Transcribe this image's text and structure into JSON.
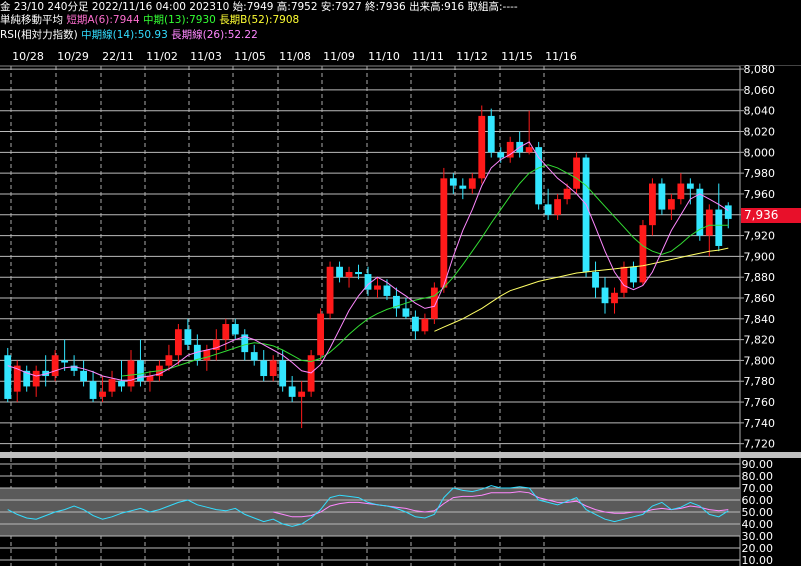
{
  "header": {
    "line1": "金 23/10 240分足 2022/11/16 04:00 202310 始:7949 高:7952 安:7927 終:7936 出来高:916 取組高:----",
    "ma_title": "単純移動平均",
    "ma_short": "短期A(6):7944",
    "ma_mid": "中期(13):7930",
    "ma_long": "長期B(52):7908",
    "rsi_title": "RSI(相対力指数)",
    "rsi_mid": "中期線(14):50.93",
    "rsi_long": "長期線(26):52.22"
  },
  "price_tag": "7,936",
  "colors": {
    "up": "#ff1a1a",
    "down": "#33e6ff",
    "ma_short": "#ff88ff",
    "ma_mid": "#33dd33",
    "ma_long": "#ffff66",
    "rsi_mid": "#33ddff",
    "rsi_long": "#ff88ff",
    "tag": "#e8102a"
  },
  "chart_data": [
    {
      "type": "candlestick",
      "x_labels": [
        "10/28",
        "10/29",
        "22/11",
        "11/02",
        "11/03",
        "11/05",
        "11/08",
        "11/09",
        "11/10",
        "11/11",
        "11/12",
        "11/15",
        "11/16"
      ],
      "y_ticks": [
        "8,080",
        "8,060",
        "8,040",
        "8,020",
        "8,000",
        "7,980",
        "7,960",
        "7,940",
        "7,920",
        "7,900",
        "7,880",
        "7,860",
        "7,840",
        "7,820",
        "7,800",
        "7,780",
        "7,760",
        "7,740",
        "7,720"
      ],
      "ylim": [
        7712,
        8082
      ],
      "grid": true,
      "candles": [
        [
          7805,
          7812,
          7760,
          7763
        ],
        [
          7770,
          7800,
          7760,
          7795
        ],
        [
          7790,
          7795,
          7770,
          7775
        ],
        [
          7775,
          7795,
          7765,
          7790
        ],
        [
          7790,
          7805,
          7775,
          7785
        ],
        [
          7785,
          7810,
          7780,
          7805
        ],
        [
          7800,
          7820,
          7790,
          7798
        ],
        [
          7795,
          7805,
          7785,
          7790
        ],
        [
          7790,
          7800,
          7775,
          7780
        ],
        [
          7780,
          7790,
          7760,
          7763
        ],
        [
          7765,
          7785,
          7760,
          7770
        ],
        [
          7770,
          7790,
          7765,
          7782
        ],
        [
          7780,
          7800,
          7770,
          7775
        ],
        [
          7775,
          7810,
          7770,
          7800
        ],
        [
          7800,
          7820,
          7775,
          7780
        ],
        [
          7780,
          7790,
          7770,
          7785
        ],
        [
          7785,
          7800,
          7780,
          7795
        ],
        [
          7795,
          7815,
          7790,
          7805
        ],
        [
          7805,
          7835,
          7795,
          7830
        ],
        [
          7830,
          7840,
          7810,
          7815
        ],
        [
          7815,
          7825,
          7795,
          7800
        ],
        [
          7800,
          7815,
          7790,
          7810
        ],
        [
          7810,
          7830,
          7800,
          7820
        ],
        [
          7820,
          7840,
          7810,
          7835
        ],
        [
          7835,
          7840,
          7820,
          7825
        ],
        [
          7825,
          7830,
          7800,
          7808
        ],
        [
          7808,
          7815,
          7795,
          7800
        ],
        [
          7800,
          7810,
          7780,
          7785
        ],
        [
          7785,
          7805,
          7780,
          7800
        ],
        [
          7800,
          7810,
          7770,
          7775
        ],
        [
          7775,
          7785,
          7760,
          7765
        ],
        [
          7765,
          7780,
          7735,
          7770
        ],
        [
          7770,
          7810,
          7765,
          7805
        ],
        [
          7805,
          7850,
          7800,
          7845
        ],
        [
          7845,
          7895,
          7840,
          7890
        ],
        [
          7890,
          7895,
          7875,
          7880
        ],
        [
          7880,
          7890,
          7870,
          7885
        ],
        [
          7885,
          7892,
          7878,
          7883
        ],
        [
          7883,
          7890,
          7862,
          7868
        ],
        [
          7868,
          7880,
          7860,
          7872
        ],
        [
          7872,
          7878,
          7858,
          7862
        ],
        [
          7862,
          7870,
          7842,
          7850
        ],
        [
          7850,
          7860,
          7840,
          7842
        ],
        [
          7842,
          7848,
          7820,
          7828
        ],
        [
          7828,
          7845,
          7825,
          7840
        ],
        [
          7840,
          7875,
          7835,
          7870
        ],
        [
          7870,
          7985,
          7865,
          7975
        ],
        [
          7975,
          7980,
          7960,
          7968
        ],
        [
          7968,
          7975,
          7955,
          7965
        ],
        [
          7965,
          7980,
          7960,
          7975
        ],
        [
          7975,
          8045,
          7970,
          8035
        ],
        [
          8035,
          8042,
          7995,
          8000
        ],
        [
          8000,
          8005,
          7990,
          7995
        ],
        [
          7995,
          8015,
          7990,
          8010
        ],
        [
          8010,
          8020,
          7995,
          8000
        ],
        [
          8000,
          8040,
          7998,
          8005
        ],
        [
          8005,
          8010,
          7945,
          7950
        ],
        [
          7950,
          7965,
          7935,
          7940
        ],
        [
          7940,
          7960,
          7935,
          7955
        ],
        [
          7955,
          7970,
          7950,
          7965
        ],
        [
          7965,
          8000,
          7960,
          7995
        ],
        [
          7995,
          7998,
          7880,
          7885
        ],
        [
          7885,
          7895,
          7860,
          7870
        ],
        [
          7870,
          7880,
          7845,
          7855
        ],
        [
          7855,
          7870,
          7845,
          7865
        ],
        [
          7865,
          7895,
          7860,
          7890
        ],
        [
          7890,
          7895,
          7870,
          7875
        ],
        [
          7875,
          7935,
          7872,
          7930
        ],
        [
          7930,
          7975,
          7920,
          7970
        ],
        [
          7970,
          7975,
          7940,
          7945
        ],
        [
          7945,
          7960,
          7935,
          7955
        ],
        [
          7955,
          7980,
          7950,
          7970
        ],
        [
          7970,
          7975,
          7950,
          7965
        ],
        [
          7965,
          7970,
          7915,
          7920
        ],
        [
          7920,
          7950,
          7900,
          7945
        ],
        [
          7945,
          7970,
          7905,
          7910
        ],
        [
          7949,
          7952,
          7927,
          7936
        ]
      ],
      "ma_short": [
        7795,
        7792,
        7788,
        7785,
        7787,
        7790,
        7793,
        7794,
        7792,
        7789,
        7785,
        7783,
        7781,
        7781,
        7784,
        7785,
        7787,
        7792,
        7798,
        7805,
        7808,
        7810,
        7812,
        7816,
        7820,
        7823,
        7820,
        7815,
        7810,
        7805,
        7798,
        7790,
        7788,
        7796,
        7812,
        7830,
        7848,
        7862,
        7873,
        7880,
        7875,
        7868,
        7862,
        7855,
        7850,
        7852,
        7872,
        7900,
        7925,
        7945,
        7968,
        7985,
        7993,
        7998,
        8005,
        8010,
        7995,
        7985,
        7975,
        7968,
        7960,
        7950,
        7928,
        7905,
        7885,
        7872,
        7868,
        7872,
        7885,
        7905,
        7925,
        7940,
        7955,
        7960,
        7955,
        7950,
        7944
      ],
      "ma_mid": [
        null,
        null,
        null,
        null,
        null,
        null,
        null,
        null,
        null,
        null,
        null,
        null,
        7785,
        7786,
        7787,
        7789,
        7790,
        7792,
        7795,
        7798,
        7801,
        7803,
        7806,
        7809,
        7812,
        7815,
        7817,
        7816,
        7814,
        7810,
        7805,
        7800,
        7799,
        7802,
        7808,
        7816,
        7825,
        7833,
        7840,
        7845,
        7849,
        7852,
        7855,
        7858,
        7860,
        7862,
        7870,
        7880,
        7892,
        7905,
        7918,
        7932,
        7945,
        7958,
        7970,
        7980,
        7985,
        7988,
        7985,
        7980,
        7975,
        7968,
        7958,
        7948,
        7938,
        7928,
        7918,
        7910,
        7905,
        7902,
        7905,
        7912,
        7920,
        7926,
        7930,
        7930,
        7930
      ],
      "ma_long": [
        null,
        null,
        null,
        null,
        null,
        null,
        null,
        null,
        null,
        null,
        null,
        null,
        null,
        null,
        null,
        null,
        null,
        null,
        null,
        null,
        null,
        null,
        null,
        null,
        null,
        null,
        null,
        null,
        null,
        null,
        null,
        null,
        null,
        null,
        null,
        null,
        null,
        null,
        null,
        null,
        null,
        null,
        null,
        null,
        null,
        7828,
        7832,
        7836,
        7840,
        7845,
        7850,
        7856,
        7862,
        7867,
        7870,
        7873,
        7876,
        7878,
        7880,
        7882,
        7884,
        7885,
        7886,
        7887,
        7888,
        7889,
        7890,
        7891,
        7893,
        7895,
        7897,
        7899,
        7901,
        7903,
        7905,
        7906,
        7908
      ]
    },
    {
      "type": "line",
      "title": "RSI",
      "y_ticks": [
        "90.00",
        "80.00",
        "70.00",
        "60.00",
        "50.00",
        "40.00",
        "30.00",
        "20.00",
        "10.00"
      ],
      "ylim": [
        5,
        95
      ],
      "series": [
        {
          "name": "中期線(14)",
          "values": [
            null,
            null,
            null,
            null,
            null,
            null,
            null,
            null,
            null,
            null,
            null,
            null,
            null,
            null,
            null,
            null,
            null,
            null,
            null,
            null,
            null,
            null,
            null,
            null,
            null,
            null,
            null,
            null,
            null,
            null,
            null,
            null,
            null,
            null,
            null,
            null,
            null,
            null,
            null,
            null,
            null,
            null,
            null,
            null,
            null,
            null,
            null,
            null,
            null,
            null,
            null,
            null,
            null,
            null,
            null,
            null,
            null,
            null,
            null,
            null,
            null,
            null,
            null,
            null,
            null,
            null,
            null,
            null,
            null,
            null,
            null,
            null,
            null,
            null,
            null,
            null,
            null
          ]
        }
      ]
    }
  ],
  "rsi": {
    "mid": [
      52,
      48,
      45,
      44,
      47,
      50,
      52,
      55,
      52,
      47,
      44,
      46,
      49,
      51,
      53,
      50,
      52,
      55,
      58,
      60,
      56,
      54,
      52,
      51,
      53,
      48,
      45,
      42,
      44,
      40,
      38,
      40,
      45,
      52,
      62,
      64,
      63,
      62,
      58,
      56,
      55,
      53,
      50,
      46,
      45,
      48,
      62,
      70,
      68,
      67,
      69,
      72,
      70,
      70,
      71,
      70,
      60,
      58,
      56,
      59,
      62,
      52,
      48,
      44,
      42,
      44,
      46,
      48,
      55,
      58,
      52,
      54,
      58,
      55,
      48,
      46,
      51
    ],
    "long": [
      null,
      null,
      null,
      null,
      null,
      null,
      null,
      null,
      null,
      null,
      null,
      null,
      null,
      null,
      null,
      null,
      null,
      null,
      null,
      null,
      null,
      null,
      null,
      null,
      null,
      null,
      null,
      null,
      50,
      48,
      46,
      46,
      47,
      50,
      55,
      57,
      58,
      58,
      57,
      56,
      55,
      54,
      53,
      51,
      50,
      51,
      57,
      62,
      63,
      63,
      64,
      66,
      66,
      66,
      67,
      66,
      62,
      60,
      58,
      58,
      59,
      55,
      52,
      50,
      49,
      49,
      50,
      50,
      52,
      53,
      52,
      53,
      55,
      54,
      52,
      51,
      52
    ]
  }
}
